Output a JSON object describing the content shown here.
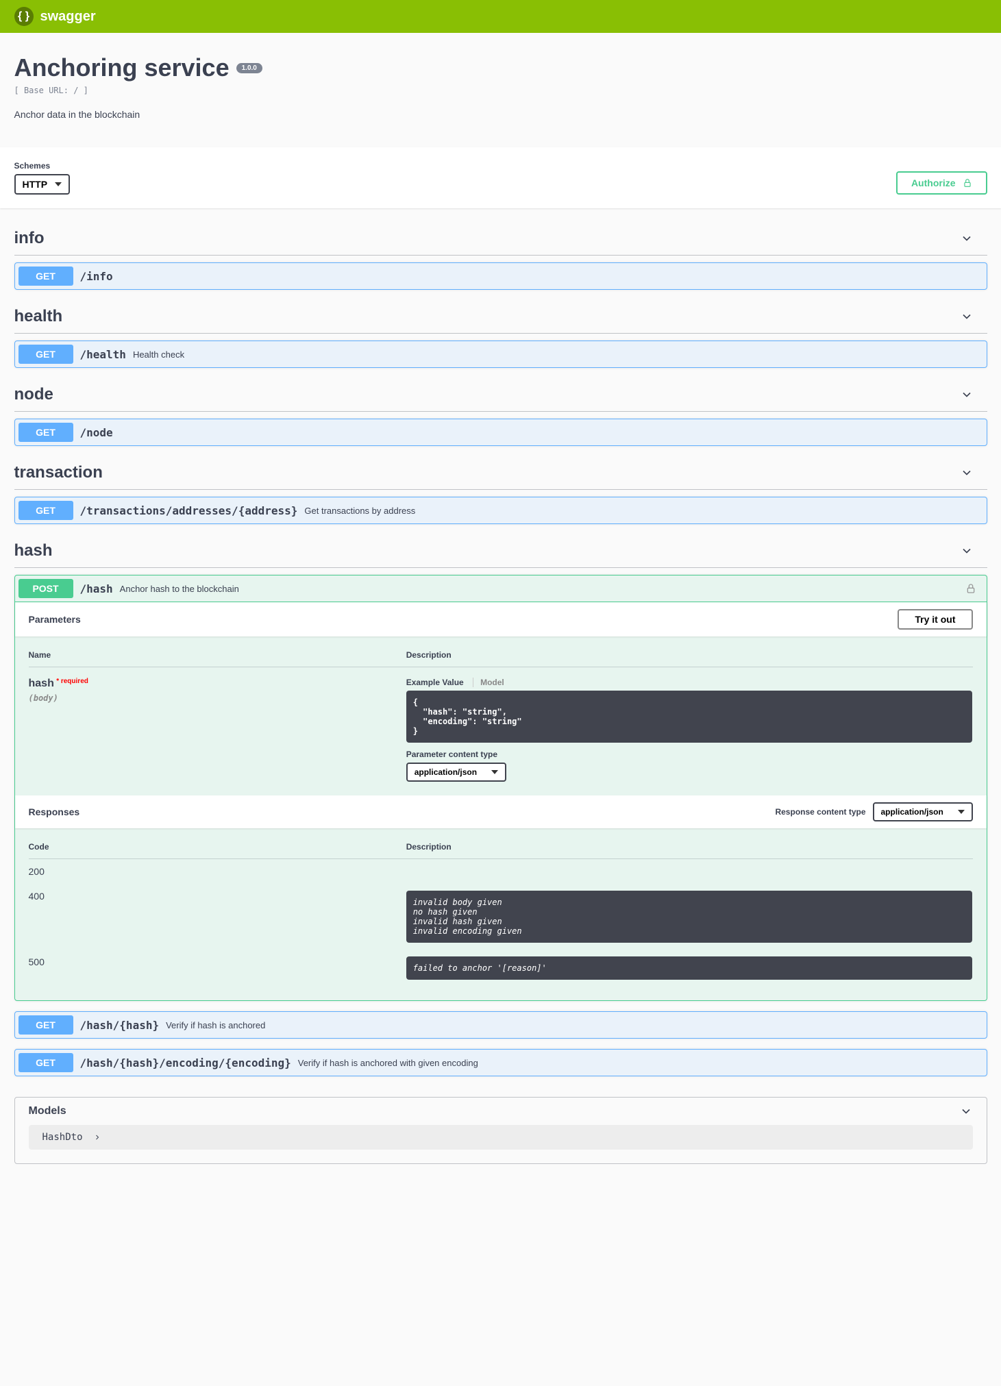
{
  "topbar": {
    "logo_text": "swagger"
  },
  "info": {
    "title": "Anchoring service",
    "version": "1.0.0",
    "base_url_label": "[ Base URL: / ]",
    "description": "Anchor data in the blockchain"
  },
  "schemes": {
    "label": "Schemes",
    "selected": "HTTP"
  },
  "authorize": {
    "label": "Authorize"
  },
  "tags": {
    "info": {
      "name": "info"
    },
    "health": {
      "name": "health"
    },
    "node": {
      "name": "node"
    },
    "transaction": {
      "name": "transaction"
    },
    "hash": {
      "name": "hash"
    }
  },
  "ops": {
    "info_get": {
      "method": "GET",
      "path": "/info",
      "summary": ""
    },
    "health_get": {
      "method": "GET",
      "path": "/health",
      "summary": "Health check"
    },
    "node_get": {
      "method": "GET",
      "path": "/node",
      "summary": ""
    },
    "tx_get": {
      "method": "GET",
      "path": "/transactions/addresses/{address}",
      "summary": "Get transactions by address"
    },
    "hash_post": {
      "method": "POST",
      "path": "/hash",
      "summary": "Anchor hash to the blockchain"
    },
    "hash_get1": {
      "method": "GET",
      "path": "/hash/{hash}",
      "summary": "Verify if hash is anchored"
    },
    "hash_get2": {
      "method": "GET",
      "path": "/hash/{hash}/encoding/{encoding}",
      "summary": "Verify if hash is anchored with given encoding"
    }
  },
  "expanded": {
    "parameters_label": "Parameters",
    "try_label": "Try it out",
    "col_name": "Name",
    "col_desc": "Description",
    "param_name": "hash",
    "required_label": "* required",
    "param_in": "(body)",
    "tab_example": "Example Value",
    "tab_model": "Model",
    "example_body": "{\n  \"hash\": \"string\",\n  \"encoding\": \"string\"\n}",
    "pct_label": "Parameter content type",
    "pct_value": "application/json",
    "responses_label": "Responses",
    "rct_label": "Response content type",
    "rct_value": "application/json",
    "resp_code_col": "Code",
    "resp_desc_col": "Description",
    "responses": {
      "r200": {
        "code": "200",
        "desc": ""
      },
      "r400": {
        "code": "400",
        "desc": "invalid body given\nno hash given\ninvalid hash given\ninvalid encoding given"
      },
      "r500": {
        "code": "500",
        "desc": "failed to anchor '[reason]'"
      }
    }
  },
  "models": {
    "header": "Models",
    "item1": "HashDto"
  }
}
